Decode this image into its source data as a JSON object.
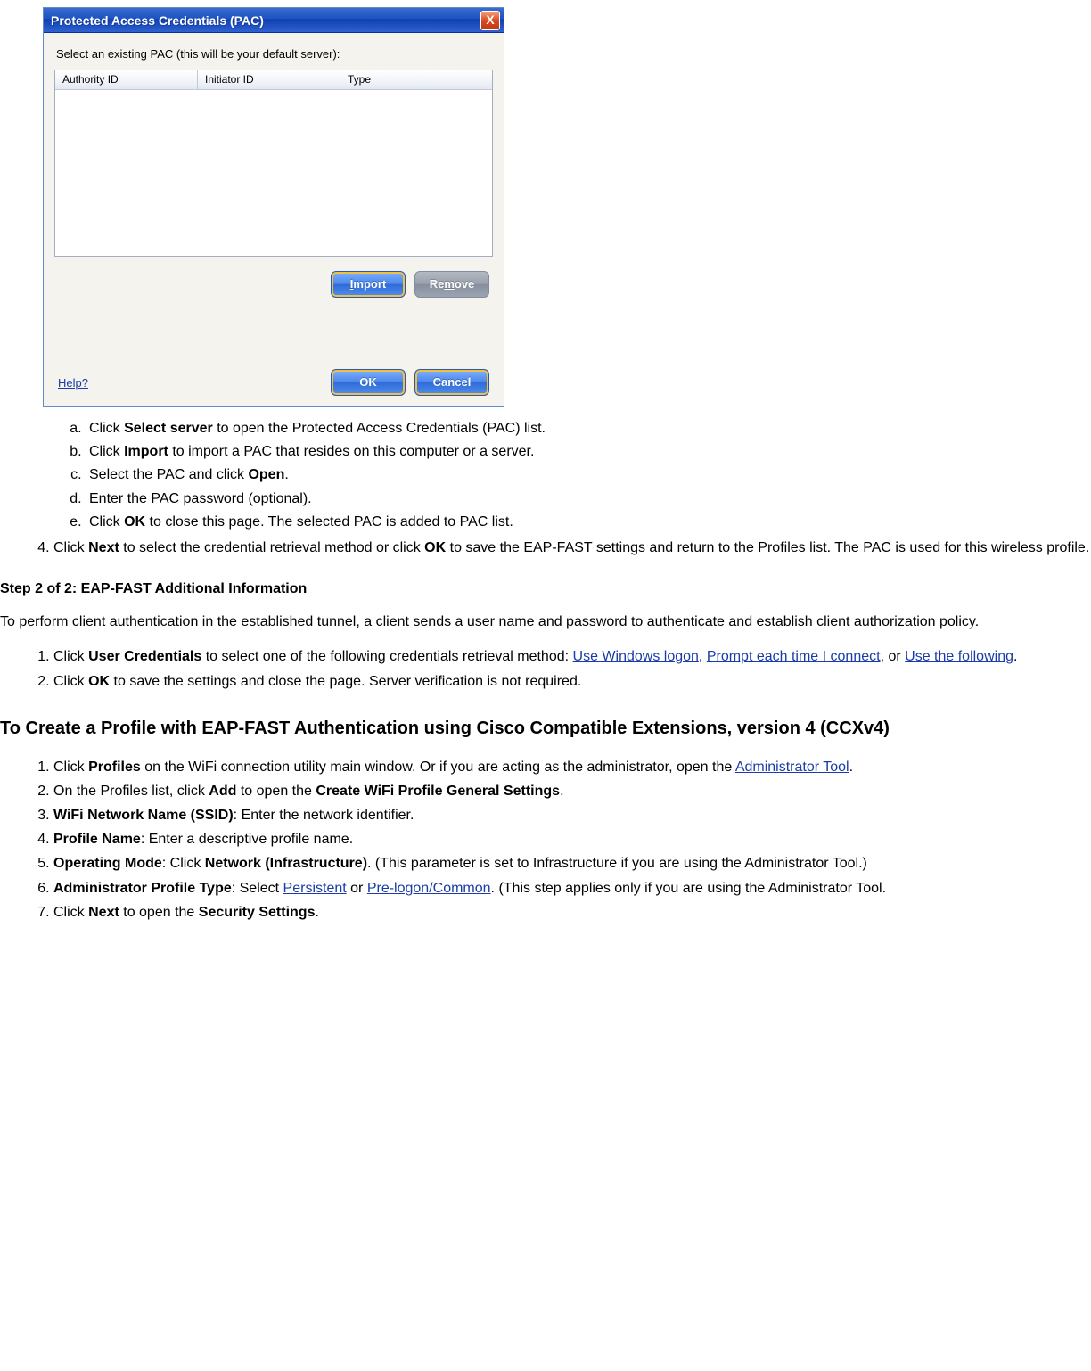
{
  "dialog": {
    "title": "Protected Access Credentials (PAC)",
    "close_glyph": "X",
    "instruction": "Select an existing PAC (this will be your default server):",
    "columns": {
      "c1": "Authority ID",
      "c2": "Initiator ID",
      "c3": "Type"
    },
    "buttons": {
      "import": "Import",
      "remove": "Remove",
      "ok": "OK",
      "cancel": "Cancel"
    },
    "help": "Help?"
  },
  "sub_a": {
    "a_pre": "Click ",
    "a_b": "Select server",
    "a_post": " to open the Protected Access Credentials (PAC) list.",
    "b_pre": "Click ",
    "b_b": "Import",
    "b_post": " to import a PAC that resides on this computer or a server.",
    "c_pre": "Select the PAC and click ",
    "c_b": "Open",
    "c_post": ".",
    "d": "Enter the PAC password (optional).",
    "e_pre": "Click ",
    "e_b": "OK",
    "e_post": " to close this page. The selected PAC is added to PAC list."
  },
  "item4": {
    "pre": "Click ",
    "b1": "Next",
    "mid": " to select the credential retrieval method or click ",
    "b2": "OK",
    "post": " to save the EAP-FAST settings and return to the Profiles list. The PAC is used for this wireless profile."
  },
  "step2_heading": "Step 2 of 2: EAP-FAST Additional Information",
  "step2_para": "To perform client authentication in the established tunnel, a client sends a user name and password to authenticate and establish client authorization policy.",
  "step2_list": {
    "i1_pre": "Click ",
    "i1_b": "User Credentials",
    "i1_mid": " to select one of the following credentials retrieval method: ",
    "link_a": "Use Windows logon",
    "sep1": ", ",
    "link_b": "Prompt each time I connect",
    "sep2": ", or ",
    "link_c": "Use the following",
    "i1_post": ".",
    "i2_pre": "Click ",
    "i2_b": "OK",
    "i2_post": " to save the settings and close the page. Server verification is not required."
  },
  "ccx_heading": "To Create a Profile with EAP-FAST Authentication using Cisco Compatible Extensions, version 4 (CCXv4)",
  "ccx": {
    "i1_pre": "Click ",
    "i1_b": "Profiles",
    "i1_mid": " on the WiFi connection utility main window. Or if you are acting as the administrator, open the ",
    "i1_link": "Administrator Tool",
    "i1_post": ".",
    "i2_pre": "On the Profiles list, click ",
    "i2_b1": "Add",
    "i2_mid": " to open the ",
    "i2_b2": "Create WiFi Profile General Settings",
    "i2_post": ".",
    "i3_b": "WiFi Network Name (SSID)",
    "i3_post": ": Enter the network identifier.",
    "i4_b": "Profile Name",
    "i4_post": ": Enter a descriptive profile name.",
    "i5_b1": "Operating Mode",
    "i5_mid": ": Click ",
    "i5_b2": "Network (Infrastructure)",
    "i5_post": ". (This parameter is set to Infrastructure if you are using the Administrator Tool.)",
    "i6_b": "Administrator Profile Type",
    "i6_mid": ": Select ",
    "i6_link1": "Persistent",
    "i6_or": " or ",
    "i6_link2": "Pre-logon/Common",
    "i6_post": ". (This step applies only if you are using the Administrator Tool.",
    "i7_pre": "Click ",
    "i7_b1": "Next",
    "i7_mid": " to open the ",
    "i7_b2": "Security Settings",
    "i7_post": "."
  }
}
